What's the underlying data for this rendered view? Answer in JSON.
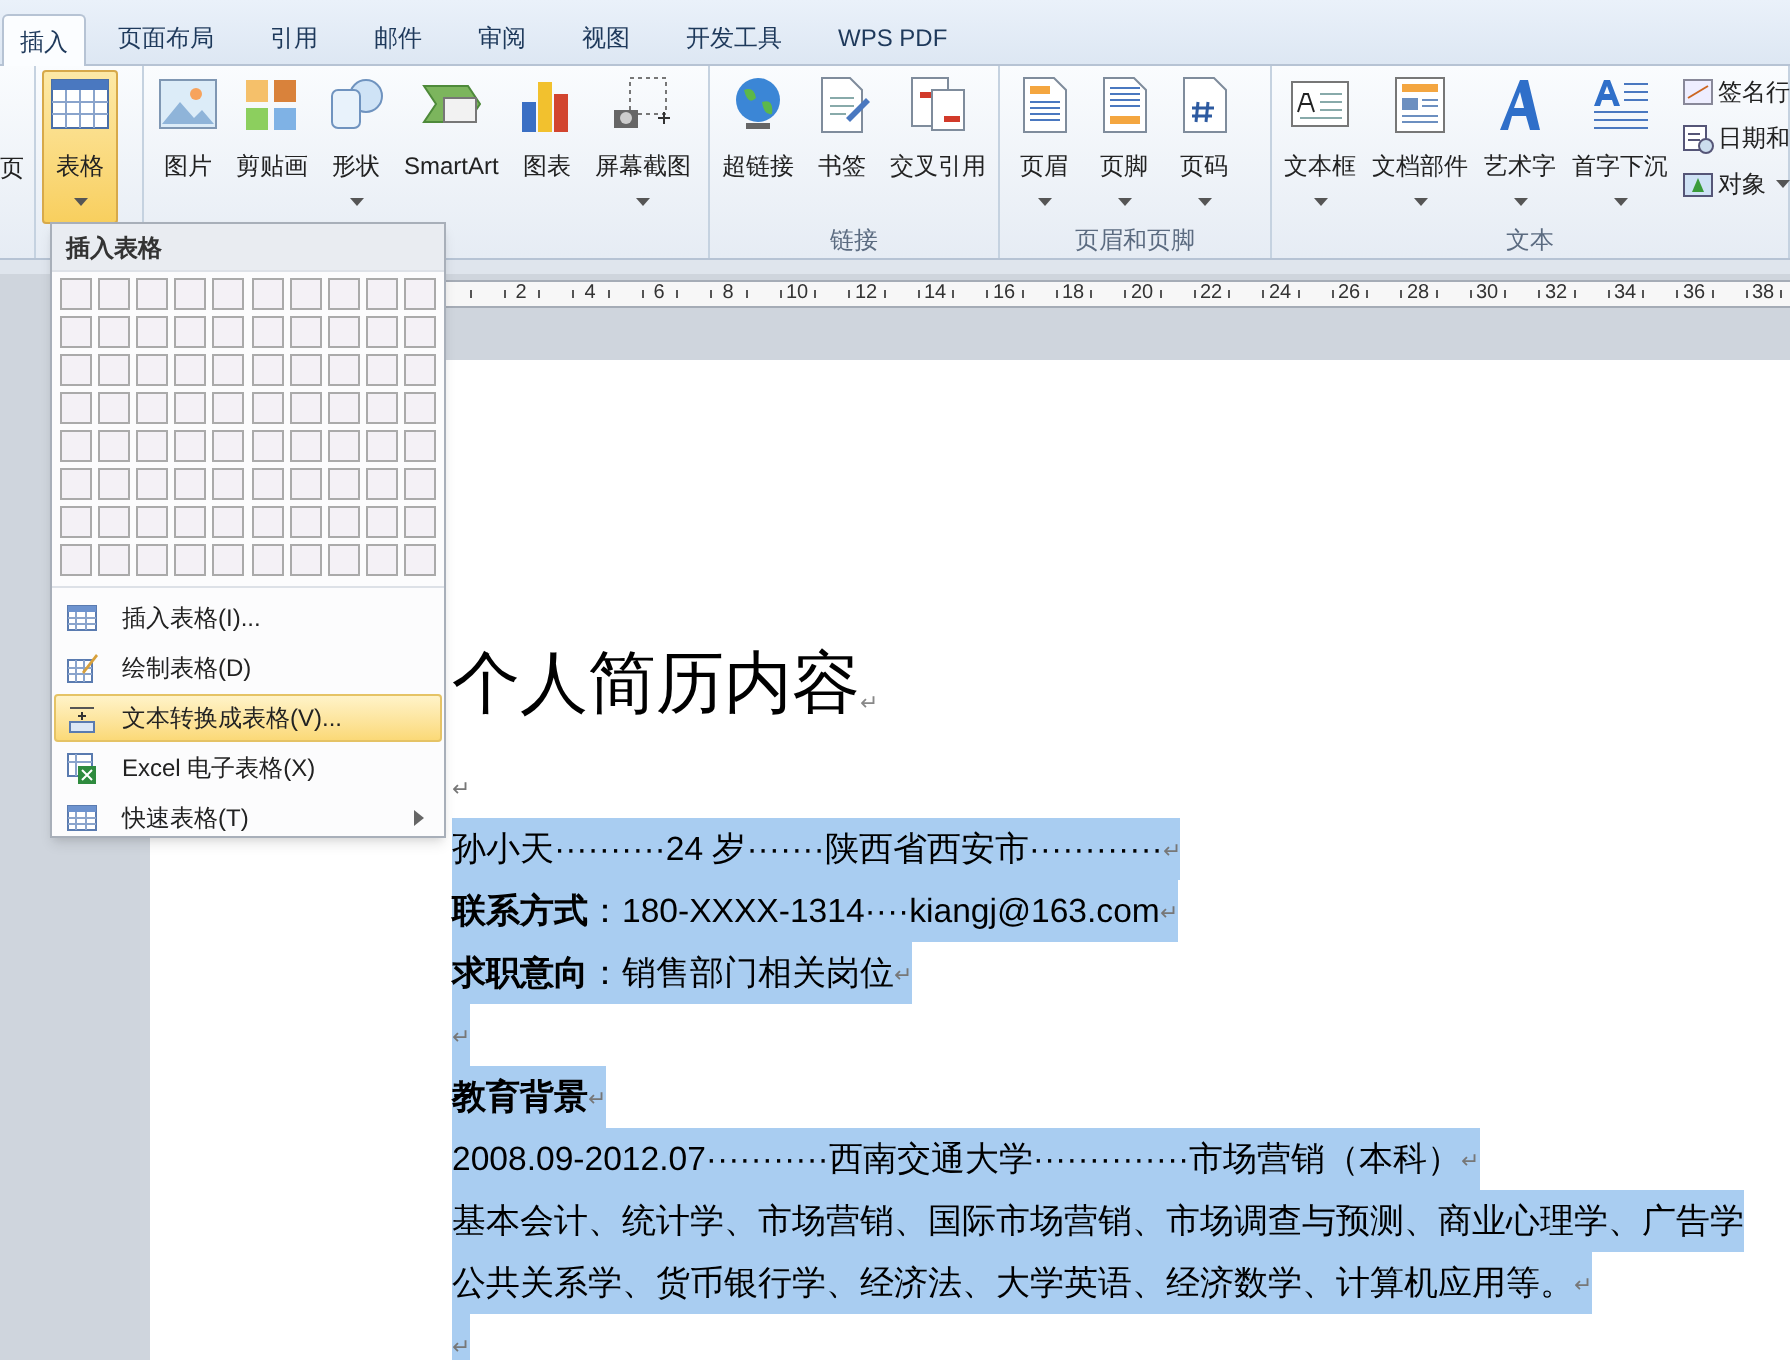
{
  "tabs": [
    {
      "label": "插入",
      "selected": true
    },
    {
      "label": "页面布局",
      "selected": false
    },
    {
      "label": "引用",
      "selected": false
    },
    {
      "label": "邮件",
      "selected": false
    },
    {
      "label": "审阅",
      "selected": false
    },
    {
      "label": "视图",
      "selected": false
    },
    {
      "label": "开发工具",
      "selected": false
    },
    {
      "label": "WPS PDF",
      "selected": false
    }
  ],
  "ribbon": {
    "partial_label": "页",
    "groups": [
      {
        "buttons": [
          {
            "label": "表格",
            "dropdown": true,
            "pressed": true
          }
        ]
      },
      {
        "buttons": [
          {
            "label": "图片",
            "dropdown": false,
            "pressed": false
          },
          {
            "label": "剪贴画",
            "dropdown": false,
            "pressed": false
          },
          {
            "label": "形状",
            "dropdown": true,
            "pressed": false
          },
          {
            "label": "SmartArt",
            "dropdown": false,
            "pressed": false
          },
          {
            "label": "图表",
            "dropdown": false,
            "pressed": false
          },
          {
            "label": "屏幕截图",
            "dropdown": true,
            "pressed": false
          }
        ]
      },
      {
        "label": "链接",
        "buttons": [
          {
            "label": "超链接",
            "dropdown": false,
            "pressed": false
          },
          {
            "label": "书签",
            "dropdown": false,
            "pressed": false
          },
          {
            "label": "交叉引用",
            "dropdown": false,
            "pressed": false
          }
        ]
      },
      {
        "label": "页眉和页脚",
        "buttons": [
          {
            "label": "页眉",
            "dropdown": true,
            "pressed": false
          },
          {
            "label": "页脚",
            "dropdown": true,
            "pressed": false
          },
          {
            "label": "页码",
            "dropdown": true,
            "pressed": false
          }
        ]
      },
      {
        "label": "文本",
        "buttons": [
          {
            "label": "文本框",
            "dropdown": true,
            "pressed": false
          },
          {
            "label": "文档部件",
            "dropdown": true,
            "pressed": false
          },
          {
            "label": "艺术字",
            "dropdown": true,
            "pressed": false
          },
          {
            "label": "首字下沉",
            "dropdown": true,
            "pressed": false
          }
        ],
        "small_buttons": [
          {
            "label": "签名行",
            "dropdown": false
          },
          {
            "label": "日期和",
            "dropdown": false
          },
          {
            "label": "对象",
            "dropdown": true
          }
        ]
      }
    ]
  },
  "ruler": {
    "labels": [
      "2",
      "4",
      "6",
      "8",
      "10",
      "12",
      "14",
      "16",
      "18",
      "20",
      "22",
      "24",
      "26",
      "28",
      "30",
      "32",
      "34",
      "36",
      "38"
    ]
  },
  "table_menu": {
    "title": "插入表格",
    "items": [
      {
        "label": "插入表格(I)...",
        "selected": false,
        "submenu": false
      },
      {
        "label": "绘制表格(D)",
        "selected": false,
        "submenu": false
      },
      {
        "label": "文本转换成表格(V)...",
        "selected": true,
        "submenu": false
      },
      {
        "label": "Excel 电子表格(X)",
        "selected": false,
        "submenu": false
      },
      {
        "label": "快速表格(T)",
        "selected": false,
        "submenu": true
      }
    ]
  },
  "document": {
    "title": "个人简历内容",
    "title_mark": "↵",
    "paragraphs": [
      {
        "mark": "↵",
        "selected": false
      },
      {
        "text": "孙小天··········24 岁·······陕西省西安市············",
        "mark": "↵",
        "selected": true
      },
      {
        "text": "**联系方式**：180-XXXX-1314····kiangj@163.com",
        "mark": "↵",
        "selected": true
      },
      {
        "text": "**求职意向**：销售部门相关岗位",
        "mark": "↵",
        "selected": true
      },
      {
        "mark": "↵",
        "selected": true
      },
      {
        "text": "**教育背景**",
        "mark": "↵",
        "selected": true
      },
      {
        "text": "2008.09-2012.07···········西南交通大学··············市场营销（本科）",
        "mark": "↵",
        "selected": true
      },
      {
        "text": "基本会计、统计学、市场营销、国际市场营销、市场调查与预测、商业心理学、广告学",
        "selected": true
      },
      {
        "text": "公共关系学、货币银行学、经济法、大学英语、经济数学、计算机应用等。",
        "mark": "↵",
        "selected": true
      },
      {
        "mark": "↵",
        "selected": true
      }
    ]
  }
}
